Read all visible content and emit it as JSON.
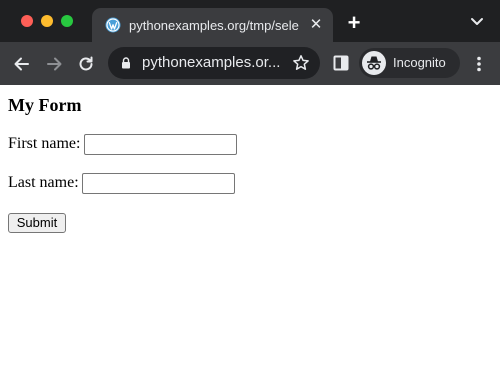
{
  "browser": {
    "tab": {
      "title": "pythonexamples.org/tmp/selen",
      "favicon": "wordpress-icon",
      "close_label": "✕"
    },
    "new_tab_label": "+",
    "address_bar": {
      "url": "pythonexamples.or...",
      "lock_icon": "lock-icon",
      "bookmark_icon": "star-icon"
    },
    "profile": {
      "label": "Incognito",
      "icon": "incognito-icon"
    },
    "colors": {
      "titlebar": "#1f2022",
      "toolbar": "#3b3c3f",
      "omnibox": "#202124",
      "traffic_red": "#fe5f57",
      "traffic_yellow": "#febc2e",
      "traffic_green": "#28c840"
    }
  },
  "page": {
    "heading": "My Form",
    "fields": [
      {
        "label": "First name:",
        "value": "",
        "placeholder": ""
      },
      {
        "label": "Last name:",
        "value": "",
        "placeholder": ""
      }
    ],
    "submit_label": "Submit"
  }
}
